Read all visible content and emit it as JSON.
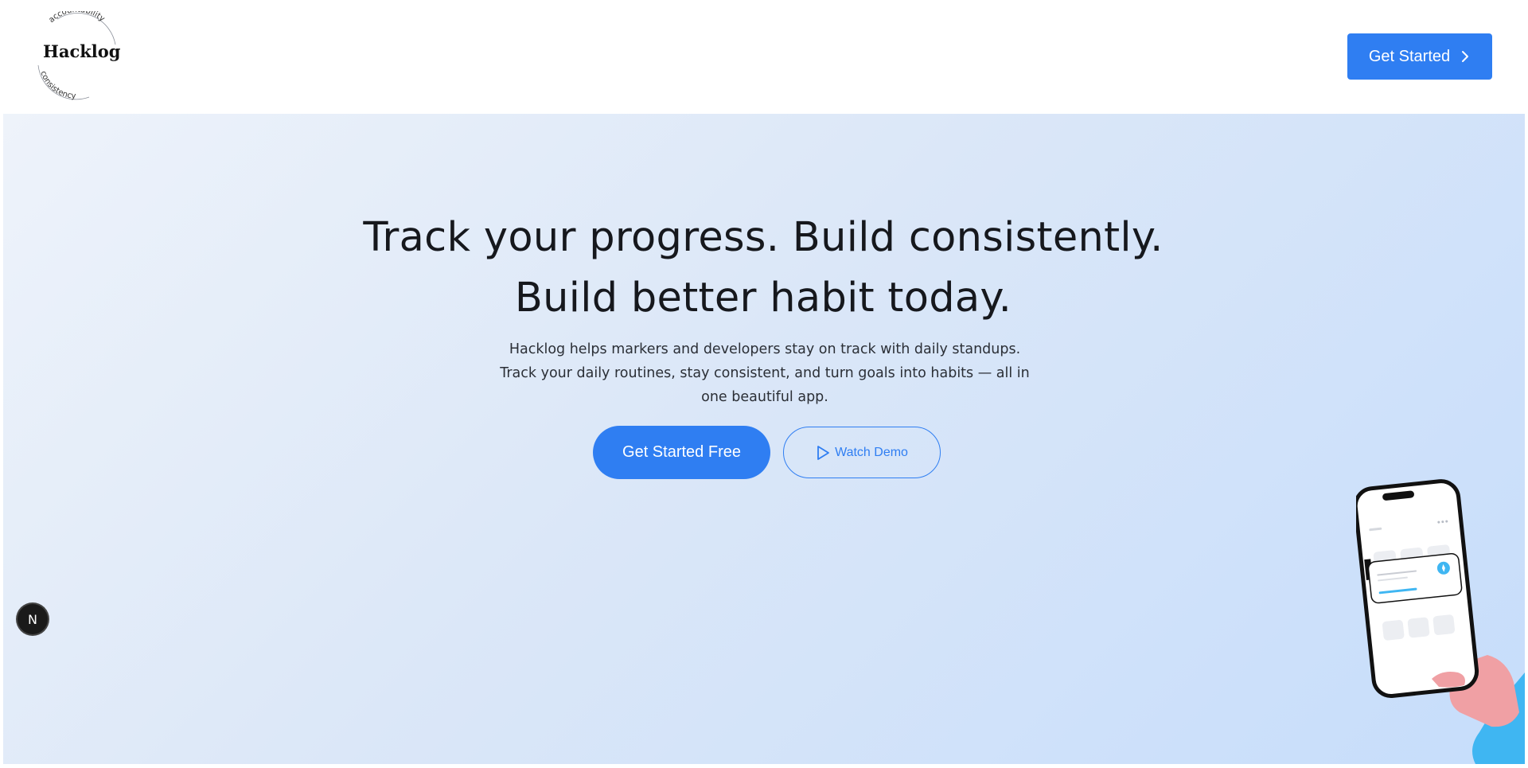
{
  "header": {
    "logo": {
      "wordmark": "Hacklog",
      "ring_top": "accountability",
      "ring_bottom": "consistency"
    },
    "cta_label": "Get Started",
    "cta_icon": "chevron-right-icon"
  },
  "hero": {
    "title": "Track your progress. Build consistently. Build better habit today.",
    "subtitle": "Hacklog helps markers and developers stay on track with daily standups. Track your daily routines, stay consistent, and turn goals into habits — all in one beautiful app.",
    "primary_cta": "Get Started Free",
    "secondary_cta": "Watch Demo",
    "secondary_icon": "play-icon"
  },
  "dev_badge": {
    "letter": "N",
    "icon": "nextjs-icon"
  },
  "colors": {
    "accent": "#2f7ef2",
    "text_dark": "#16181d",
    "hero_gradient_start": "#eef3fa",
    "hero_gradient_end": "#c6ddfb"
  }
}
